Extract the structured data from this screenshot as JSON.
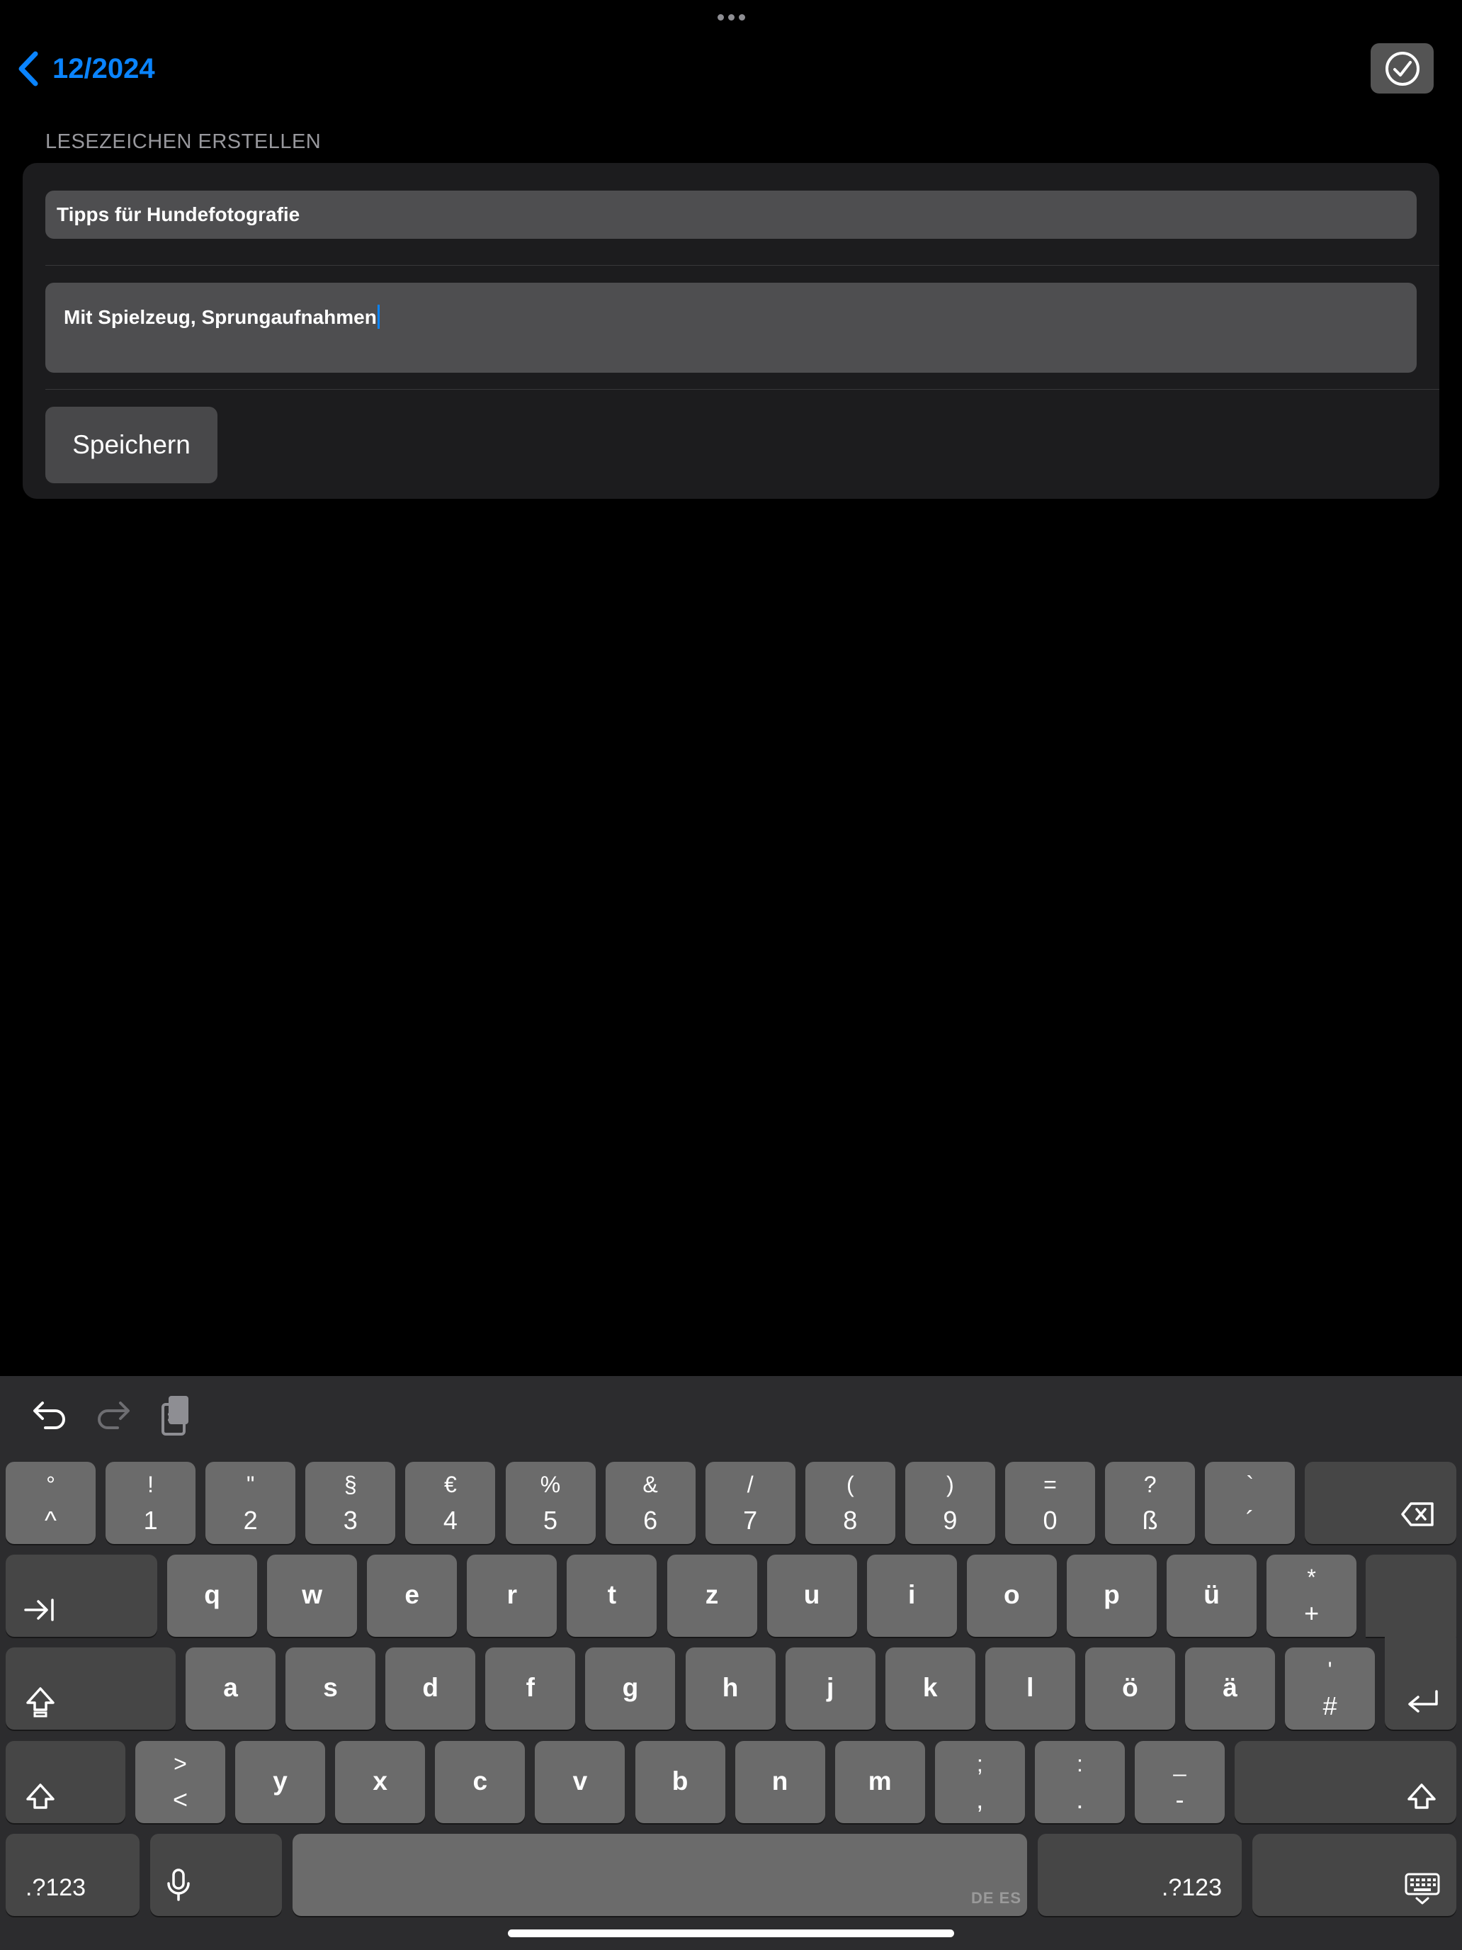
{
  "nav": {
    "back_label": "12/2024",
    "done_icon": "checkmark-circle-icon"
  },
  "form": {
    "section_header": "LESEZEICHEN ERSTELLEN",
    "title_value": "Tipps für Hundefotografie",
    "note_value": "Mit Spielzeug, Sprungaufnahmen",
    "save_label": "Speichern"
  },
  "colors": {
    "accent": "#0a84ff",
    "background": "#000000",
    "card": "#1c1c1e",
    "field": "#4e4e50",
    "key": "#6b6b6b",
    "key_dark": "#464646"
  },
  "keyboard": {
    "toolbar": [
      "undo-icon",
      "redo-icon",
      "clipboard-icon"
    ],
    "number_row": [
      {
        "top": "°",
        "bottom": "^"
      },
      {
        "top": "!",
        "bottom": "1"
      },
      {
        "top": "\"",
        "bottom": "2"
      },
      {
        "top": "§",
        "bottom": "3"
      },
      {
        "top": "€",
        "bottom": "4"
      },
      {
        "top": "%",
        "bottom": "5"
      },
      {
        "top": "&",
        "bottom": "6"
      },
      {
        "top": "/",
        "bottom": "7"
      },
      {
        "top": "(",
        "bottom": "8"
      },
      {
        "top": ")",
        "bottom": "9"
      },
      {
        "top": "=",
        "bottom": "0"
      },
      {
        "top": "?",
        "bottom": "ß"
      },
      {
        "top": "`",
        "bottom": "´"
      }
    ],
    "row_q": [
      "q",
      "w",
      "e",
      "r",
      "t",
      "z",
      "u",
      "i",
      "o",
      "p",
      "ü"
    ],
    "row_q_extra": {
      "top": "*",
      "bottom": "+"
    },
    "row_a": [
      "a",
      "s",
      "d",
      "f",
      "g",
      "h",
      "j",
      "k",
      "l",
      "ö",
      "ä"
    ],
    "row_a_extra": {
      "top": "'",
      "bottom": "#"
    },
    "row_y_first": {
      "top": ">",
      "bottom": "<"
    },
    "row_y": [
      "y",
      "x",
      "c",
      "v",
      "b",
      "n",
      "m"
    ],
    "row_y_punct": [
      {
        "top": ";",
        "bottom": ","
      },
      {
        "top": ":",
        "bottom": "."
      },
      {
        "top": "_",
        "bottom": "-"
      }
    ],
    "numbers_label": ".?123",
    "space_languages": "DE ES",
    "special_icons": [
      "delete-icon",
      "tab-icon",
      "caps-lock-icon",
      "return-icon",
      "shift-icon",
      "microphone-icon",
      "keyboard-dismiss-icon"
    ]
  }
}
